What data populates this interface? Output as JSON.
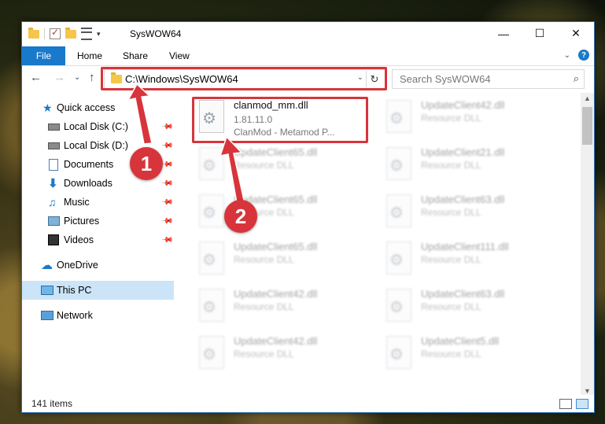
{
  "window": {
    "title": "SysWOW64",
    "controls": {
      "minimize": "—",
      "maximize": "☐",
      "close": "✕"
    }
  },
  "ribbon": {
    "tabs": [
      "File",
      "Home",
      "Share",
      "View"
    ],
    "help": "?",
    "collapse_chevron": "⌄"
  },
  "nav": {
    "back": "←",
    "forward": "→",
    "recent": "⌄",
    "up": "↑",
    "address": "C:\\Windows\\SysWOW64",
    "address_dropdown": "⌄",
    "refresh": "↻",
    "search_placeholder": "Search SysWOW64",
    "search_icon": "⌕"
  },
  "sidebar": {
    "items": [
      {
        "label": "Quick access",
        "icon": "star-icon",
        "pinned": false
      },
      {
        "label": "Local Disk (C:)",
        "icon": "drive-icon",
        "pinned": true
      },
      {
        "label": "Local Disk (D:)",
        "icon": "drive-icon",
        "pinned": true
      },
      {
        "label": "Documents",
        "icon": "documents-icon",
        "pinned": true
      },
      {
        "label": "Downloads",
        "icon": "download-icon",
        "pinned": true
      },
      {
        "label": "Music",
        "icon": "music-icon",
        "pinned": true
      },
      {
        "label": "Pictures",
        "icon": "pictures-icon",
        "pinned": true
      },
      {
        "label": "Videos",
        "icon": "videos-icon",
        "pinned": true
      },
      {
        "label": "OneDrive",
        "icon": "cloud-icon",
        "pinned": false
      },
      {
        "label": "This PC",
        "icon": "computer-icon",
        "pinned": false,
        "selected": true
      },
      {
        "label": "Network",
        "icon": "network-icon",
        "pinned": false
      }
    ],
    "pin_glyph": "📌"
  },
  "files": {
    "main": {
      "name": "clanmod_mm.dll",
      "version": "1.81.11.0",
      "description": "ClanMod - Metamod P..."
    },
    "blurred_left": [
      {
        "name": "UpdateClient65.dll",
        "type": "Resource DLL"
      },
      {
        "name": "UpdateClient65.dll",
        "type": "Resource DLL"
      },
      {
        "name": "UpdateClient65.dll",
        "type": "Resource DLL"
      },
      {
        "name": "UpdateClient42.dll",
        "type": "Resource DLL"
      },
      {
        "name": "UpdateClient42.dll",
        "type": "Resource DLL"
      }
    ],
    "blurred_right": [
      {
        "name": "UpdateClient42.dll",
        "type": "Resource DLL"
      },
      {
        "name": "UpdateClient21.dll",
        "type": "Resource DLL"
      },
      {
        "name": "UpdateClient63.dll",
        "type": "Resource DLL"
      },
      {
        "name": "UpdateClient111.dll",
        "type": "Resource DLL"
      },
      {
        "name": "UpdateClient63.dll",
        "type": "Resource DLL"
      },
      {
        "name": "UpdateClient5.dll",
        "type": "Resource DLL"
      }
    ]
  },
  "status": {
    "item_count": "141 items"
  },
  "annotations": {
    "callout_1": "1",
    "callout_2": "2",
    "color": "#d8343b"
  }
}
